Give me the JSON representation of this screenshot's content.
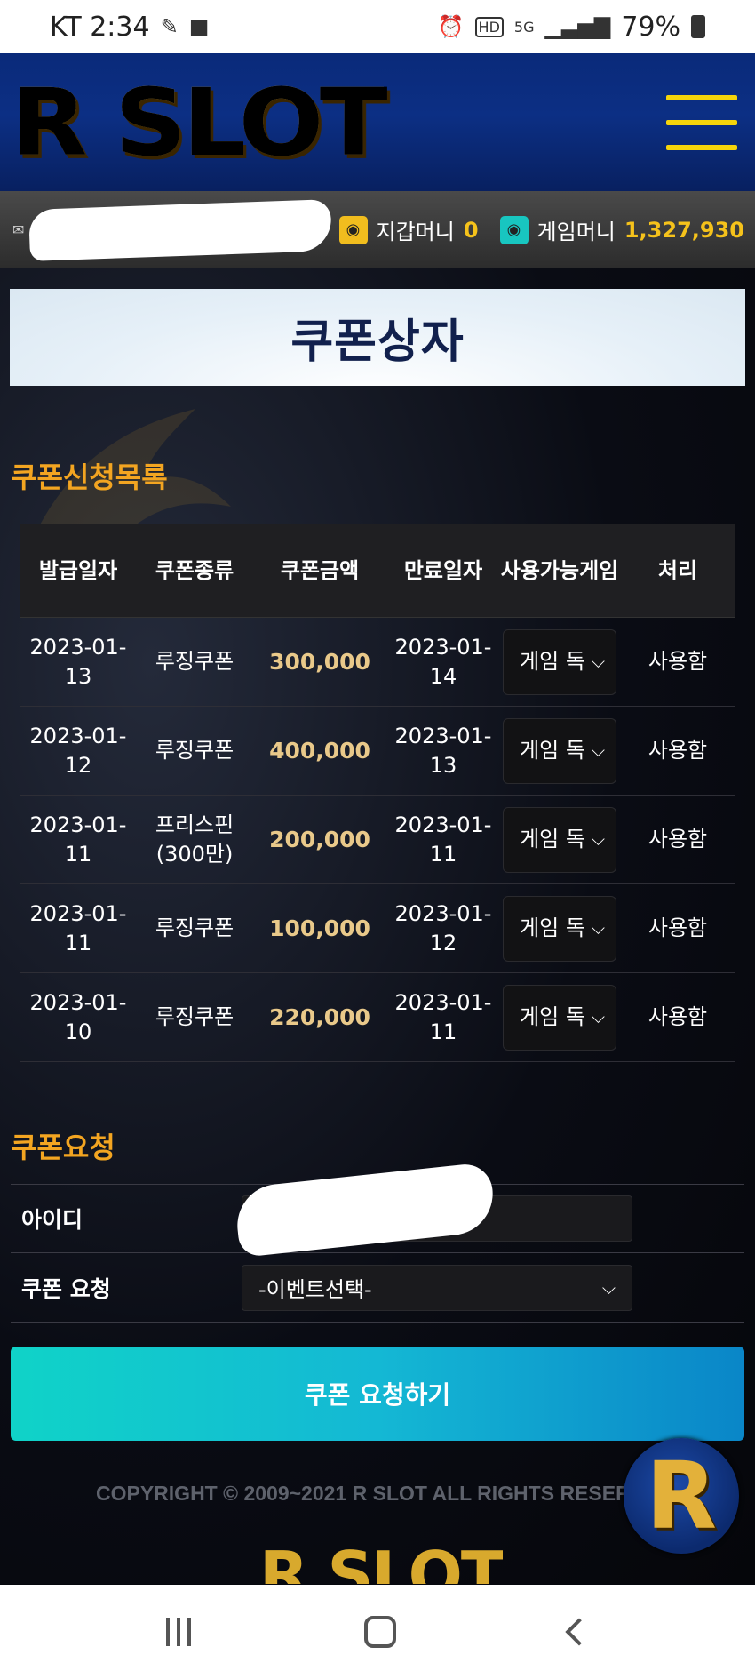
{
  "status_bar": {
    "carrier_time": "KT 2:34",
    "icons_left": [
      "pill-icon",
      "message-icon"
    ],
    "icons_right": [
      "alarm-icon",
      "hd-icon",
      "5g-icon",
      "signal-icon"
    ],
    "battery": "79%"
  },
  "header": {
    "logo": "R SLOT"
  },
  "user_bar": {
    "wallet_label": "지갑머니",
    "wallet_value": "0",
    "game_label": "게임머니",
    "game_value": "1,327,930"
  },
  "page_title": "쿠폰상자",
  "coupon_list": {
    "title": "쿠폰신청목록",
    "columns": [
      "발급일자",
      "쿠폰종류",
      "쿠폰금액",
      "만료일자",
      "사용가능게임",
      "처리"
    ],
    "rows": [
      {
        "issued": "2023-01-13",
        "type": "루징쿠폰",
        "amount": "300,000",
        "expires": "2023-01-14",
        "game": "게임 독",
        "status": "사용함"
      },
      {
        "issued": "2023-01-12",
        "type": "루징쿠폰",
        "amount": "400,000",
        "expires": "2023-01-13",
        "game": "게임 독",
        "status": "사용함"
      },
      {
        "issued": "2023-01-11",
        "type": "프리스핀(300만)",
        "amount": "200,000",
        "expires": "2023-01-11",
        "game": "게임 독",
        "status": "사용함"
      },
      {
        "issued": "2023-01-11",
        "type": "루징쿠폰",
        "amount": "100,000",
        "expires": "2023-01-12",
        "game": "게임 독",
        "status": "사용함"
      },
      {
        "issued": "2023-01-10",
        "type": "루징쿠폰",
        "amount": "220,000",
        "expires": "2023-01-11",
        "game": "게임 독",
        "status": "사용함"
      }
    ]
  },
  "request_form": {
    "title": "쿠폰요청",
    "id_label": "아이디",
    "coupon_label": "쿠폰 요청",
    "coupon_select_value": "-이벤트선택-",
    "submit_label": "쿠폰 요청하기"
  },
  "footer": {
    "copyright": "COPYRIGHT © 2009~2021 R SLOT ALL RIGHTS RESERV",
    "badge_letter": "R",
    "logo": "R SLOT"
  }
}
